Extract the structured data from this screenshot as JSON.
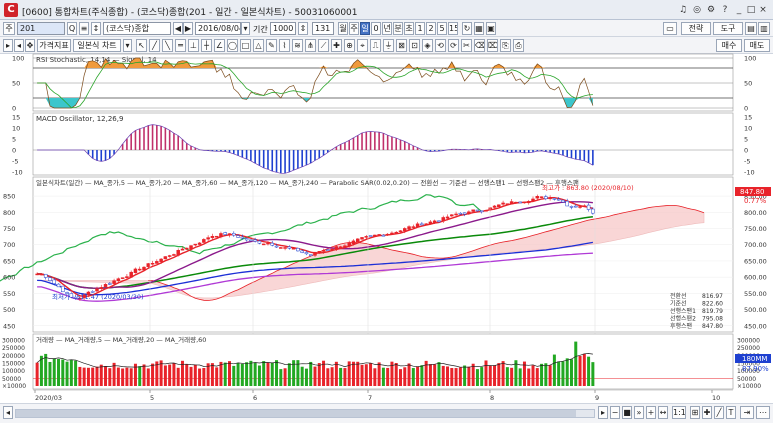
{
  "window": {
    "title": "[0600] 통합차트(주식종합) - (코스닥)종합(201 - 일간 - 일본식차트) - 50031060001"
  },
  "toolbar1": {
    "code": "201",
    "name": "(코스닥)종합",
    "date": "2016/08/04",
    "period_label": "기간",
    "period_value": "1000",
    "count_value": "131",
    "period_buttons": [
      "월",
      "주",
      "일",
      "0",
      "년",
      "분",
      "초",
      "1",
      "2",
      "5",
      "15"
    ],
    "right_buttons": [
      "전략",
      "도구"
    ],
    "arrow_prev": "◀",
    "arrow_next": "▶"
  },
  "toolbar2": {
    "tabs": [
      "가격지표",
      "일본식 차트"
    ],
    "right_buttons": [
      "매수",
      "매도"
    ]
  },
  "rsi_panel": {
    "title": "RSI Stochastic, 14,14 — Signal, 14",
    "y_ticks_left": [
      "100",
      "50",
      "0"
    ],
    "y_ticks_right": [
      "100",
      "50",
      "0"
    ]
  },
  "macd_panel": {
    "title": "MACD Oscillator, 12,26,9",
    "y_ticks_left": [
      "15",
      "10",
      "5",
      "0",
      "-5",
      "-10"
    ],
    "y_ticks_right": [
      "15",
      "10",
      "5",
      "0",
      "-5",
      "-10"
    ]
  },
  "price_panel": {
    "legend": "일본식차트(일간) — MA_종가,5 — MA_종가,20 — MA_종가,60 — MA_종가,120 — MA_종가,240 — Parabolic SAR(0.02,0.20) — 전환선 — 기준선 — 선행스팬1 — 선행스팬2 — 후행스팬",
    "y_ticks_left": [
      "850",
      "800",
      "750",
      "700",
      "650",
      "600",
      "550",
      "500",
      "450"
    ],
    "y_ticks_right": [
      "850.00",
      "800.00",
      "750.00",
      "700.00",
      "650.00",
      "600.00",
      "550.00",
      "500.00",
      "450.00"
    ],
    "high_annotation": "최고가 : 863.80 (2020/08/10)",
    "low_annotation": "최저가 : 511.47 (2020/03/30)",
    "current_price": "847.80",
    "current_pct": "0.77%",
    "readout": [
      {
        "label": "전환선",
        "value": "816.97"
      },
      {
        "label": "기준선",
        "value": "822.60"
      },
      {
        "label": "선행스팬1",
        "value": "819.79"
      },
      {
        "label": "선행스팬2",
        "value": "795.08"
      },
      {
        "label": "후행스팬",
        "value": "847.80"
      }
    ]
  },
  "volume_panel": {
    "legend": "거래량 — MA_거래량,5 — MA_거래량,20 — MA_거래량,60",
    "y_ticks_left": [
      "300000",
      "250000",
      "200000",
      "150000",
      "100000",
      "50000",
      "×10000"
    ],
    "y_ticks_right": [
      "300000",
      "250000",
      "200000",
      "150000",
      "100000",
      "50000",
      "×10000"
    ],
    "current_volume": "180MM",
    "current_pct": "87.90%"
  },
  "x_axis": {
    "labels": [
      "2020/03",
      "5",
      "6",
      "7",
      "8",
      "9",
      "10"
    ]
  },
  "colors": {
    "up": "#e8232a",
    "down": "#1e40d0",
    "ma5": "#e8232a",
    "ma20": "#8b1a8b",
    "ma60": "#0a8a0a",
    "ma120": "#1c2fd6",
    "ma240": "#b03ad6",
    "cloud": "#f7c6c6",
    "rsi_fill": "#f09a3c",
    "rsi_low_fill": "#3cc6cc",
    "signal": "#2aa52a",
    "volume_bar": "#e8232a",
    "volume_bar_alt": "#22a822"
  }
}
